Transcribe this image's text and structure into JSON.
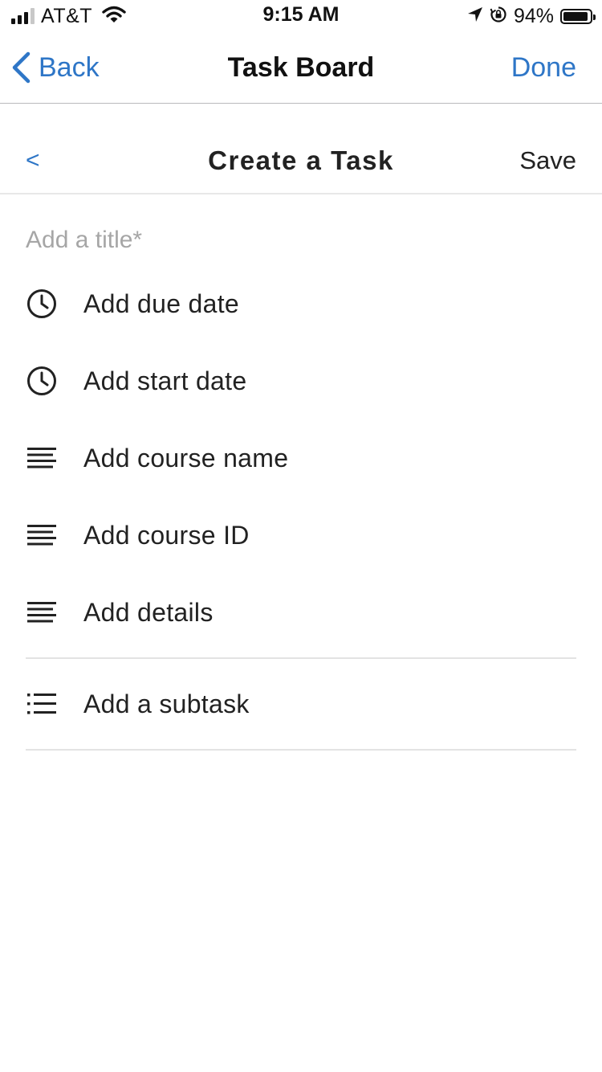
{
  "status_bar": {
    "carrier": "AT&T",
    "time": "9:15 AM",
    "battery_percent": "94%",
    "battery_level": 0.94,
    "signal_bars_filled": 3,
    "icons": [
      "signal-icon",
      "wifi-icon",
      "location-arrow-icon",
      "orientation-lock-icon",
      "battery-icon"
    ]
  },
  "nav": {
    "back_label": "Back",
    "title": "Task Board",
    "done_label": "Done"
  },
  "form_header": {
    "back_label": "<",
    "title": "Create a Task",
    "save_label": "Save"
  },
  "form": {
    "title_placeholder": "Add a title*",
    "title_value": "",
    "fields": [
      {
        "label": "Add due date",
        "icon": "clock-icon"
      },
      {
        "label": "Add start date",
        "icon": "clock-icon"
      },
      {
        "label": "Add course name",
        "icon": "text-lines-icon"
      },
      {
        "label": "Add course ID",
        "icon": "text-lines-icon"
      },
      {
        "label": "Add details",
        "icon": "text-lines-icon"
      }
    ],
    "subtask": {
      "label": "Add a subtask",
      "icon": "bullet-list-icon"
    }
  },
  "colors": {
    "accent": "#2e76c7",
    "text": "#222222",
    "placeholder": "#a6a6a6",
    "divider": "#e3e3e3"
  }
}
